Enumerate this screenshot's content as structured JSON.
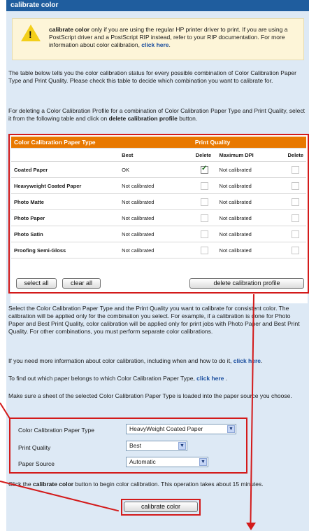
{
  "title": "calibrate color",
  "warning": {
    "icon": "warning-icon",
    "bold_lead": "calibrate color",
    "text": " only if you are using the regular HP printer driver to print. If you are using a PostScript driver and a PostScript RIP instead, refer to your RIP documentation. For more information about color calibration, ",
    "link": "click here",
    "end": "."
  },
  "intro1": "The table below tells you the color calibration status for every possible combination of Color Calibration Paper Type and Print Quality. Please check this table to decide which combination you want to calibrate for.",
  "intro2_pre": "For deleting a Color Calibration Profile for a combination of Color Calibration Paper Type and Print Quality, select it from the following table and click on ",
  "intro2_bold": "delete calibration profile",
  "intro2_post": " button.",
  "table": {
    "header_type": "Color Calibration Paper Type",
    "header_quality": "Print Quality",
    "sub_best": "Best",
    "sub_delete1": "Delete",
    "sub_maxdpi": "Maximum DPI",
    "sub_delete2": "Delete",
    "rows": [
      {
        "type": "Coated Paper",
        "best": "OK",
        "best_checked": true,
        "maxdpi": "Not calibrated"
      },
      {
        "type": "Heavyweight Coated Paper",
        "best": "Not calibrated",
        "best_checked": false,
        "maxdpi": "Not calibrated"
      },
      {
        "type": "Photo Matte",
        "best": "Not calibrated",
        "best_checked": false,
        "maxdpi": "Not calibrated"
      },
      {
        "type": "Photo Paper",
        "best": "Not calibrated",
        "best_checked": false,
        "maxdpi": "Not calibrated"
      },
      {
        "type": "Photo Satin",
        "best": "Not calibrated",
        "best_checked": false,
        "maxdpi": "Not calibrated"
      },
      {
        "type": "Proofing Semi-Gloss",
        "best": "Not calibrated",
        "best_checked": false,
        "maxdpi": "Not calibrated"
      }
    ]
  },
  "buttons": {
    "select_all": "select all",
    "clear_all": "clear all",
    "delete_profile": "delete calibration profile",
    "calibrate": "calibrate color"
  },
  "para_select": "Select the Color Calibration Paper Type and the Print Quality you want to calibrate for consistent color. The calibration will be applied only for the combination you select. For example, if a calibration is done for Photo Paper and Best Print Quality, color calibration will be applied only for print jobs with Photo Paper and Best Print Quality. For other combinations, you must perform separate color calibrations.",
  "para_more_pre": "If you need more information about color calibration, including when and how to do it, ",
  "para_more_link": "click here",
  "para_more_post": ".",
  "para_find_pre": "To find out which paper belongs to which Color Calibration Paper Type, ",
  "para_find_link": "click here",
  "para_find_post": " .",
  "para_sheet": "Make sure a sheet of the selected Color Calibration Paper Type is loaded into the paper source you choose.",
  "form": {
    "paper_type_label": "Color Calibration Paper Type",
    "paper_type_value": "HeavyWeight Coated Paper",
    "quality_label": "Print Quality",
    "quality_value": "Best",
    "source_label": "Paper Source",
    "source_value": "Automatic"
  },
  "para_click_pre": "Click the ",
  "para_click_bold": "calibrate color",
  "para_click_post": " button to begin color calibration. This operation takes about 15 minutes.",
  "colors": {
    "title_bar": "#1f5d9e",
    "panel_bg": "#dde9f5",
    "table_header": "#e87800",
    "callout": "#d31a1a",
    "link": "#1b4e9e",
    "warning_bg": "#fdf5d8"
  }
}
